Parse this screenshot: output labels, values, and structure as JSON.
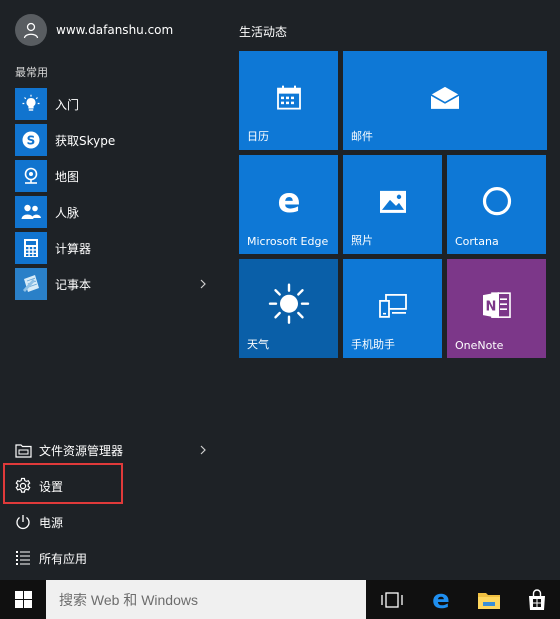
{
  "user": {
    "name": "www.dafanshu.com",
    "avatar_icon": "user-avatar-icon"
  },
  "most_used": {
    "label": "最常用",
    "items": [
      {
        "label": "入门",
        "icon": "lightbulb-icon"
      },
      {
        "label": "获取Skype",
        "icon": "skype-icon"
      },
      {
        "label": "地图",
        "icon": "maps-icon"
      },
      {
        "label": "人脉",
        "icon": "people-icon"
      },
      {
        "label": "计算器",
        "icon": "calculator-icon"
      },
      {
        "label": "记事本",
        "icon": "notepad-icon",
        "has_submenu": true
      }
    ]
  },
  "system": {
    "items": [
      {
        "label": "文件资源管理器",
        "icon": "file-explorer-icon",
        "has_submenu": true
      },
      {
        "label": "设置",
        "icon": "gear-icon",
        "highlighted": true
      },
      {
        "label": "电源",
        "icon": "power-icon"
      },
      {
        "label": "所有应用",
        "icon": "all-apps-icon"
      }
    ],
    "highlight_color": "#e03a3a"
  },
  "tiles": {
    "group_title": "生活动态",
    "items": [
      {
        "label": "日历",
        "icon": "calendar-icon",
        "color": "#0e78d6"
      },
      {
        "label": "邮件",
        "icon": "mail-icon",
        "color": "#0e78d6"
      },
      {
        "label": "Microsoft Edge",
        "icon": "edge-icon",
        "color": "#0e78d6"
      },
      {
        "label": "照片",
        "icon": "photos-icon",
        "color": "#0e78d6"
      },
      {
        "label": "Cortana",
        "icon": "cortana-icon",
        "color": "#0e78d6"
      },
      {
        "label": "天气",
        "icon": "weather-sun-icon",
        "color": "#0a5fa8"
      },
      {
        "label": "手机助手",
        "icon": "phone-companion-icon",
        "color": "#0e78d6"
      },
      {
        "label": "OneNote",
        "icon": "onenote-icon",
        "color": "#7c3789"
      }
    ]
  },
  "taskbar": {
    "search_placeholder": "搜索 Web 和 Windows",
    "icons": [
      "windows-start-icon",
      "task-view-icon",
      "edge-icon",
      "file-explorer-icon",
      "store-icon"
    ]
  },
  "colors": {
    "accent": "#0e78d6",
    "start_bg": "#1e2226",
    "taskbar_bg": "#101010"
  }
}
